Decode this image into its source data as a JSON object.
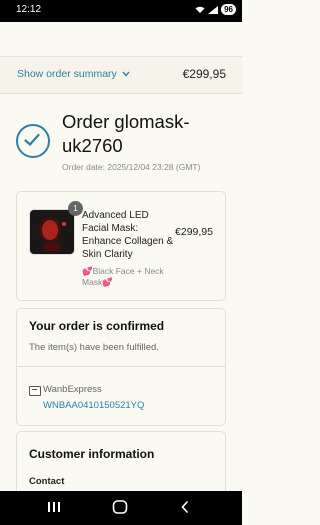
{
  "status_bar": {
    "time": "12:12",
    "battery": "96"
  },
  "summary": {
    "link_label": "Show order summary",
    "total": "€299,95"
  },
  "order": {
    "title": "Order  glomask-uk2760",
    "date": "Order date:  2025/12/04 23:28 (GMT)"
  },
  "product": {
    "quantity": "1",
    "name": "Advanced LED Facial Mask: Enhance Collagen & Skin Clarity",
    "variant": "💕Black Face + Neck Mask💕",
    "price": "€299,95"
  },
  "confirmation": {
    "title": "Your order is confirmed",
    "text": "The item(s) have been fulfilled.",
    "carrier": "WanbExpress",
    "tracking_number": "WNBAA0410150521YQ"
  },
  "customer": {
    "title": "Customer information",
    "contact_label": "Contact"
  },
  "colors": {
    "accent": "#2c7fa6",
    "background": "#faf9f2"
  }
}
